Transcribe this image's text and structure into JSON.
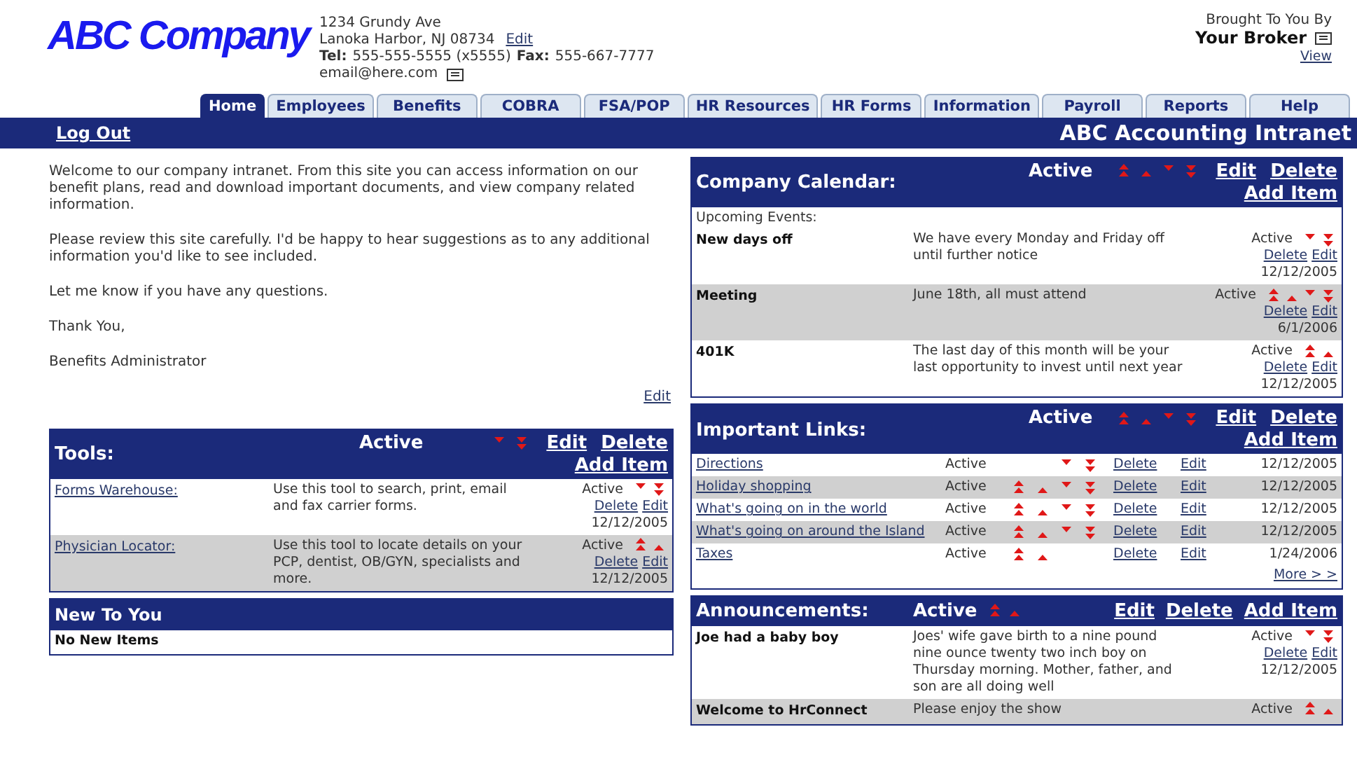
{
  "header": {
    "logo": "ABC Company",
    "address_lines": [
      "1234 Grundy Ave",
      "Lanoka Harbor, NJ 08734"
    ],
    "address_edit": "Edit",
    "tel_label": "Tel:",
    "tel": "555-555-5555 (x5555)",
    "fax_label": "Fax:",
    "fax": "555-667-7777",
    "email": "email@here.com",
    "broker": {
      "caption": "Brought To You By",
      "name": "Your Broker",
      "view": "View"
    }
  },
  "tabs": [
    {
      "label": "Home",
      "selected": true
    },
    {
      "label": "Employees",
      "selected": false
    },
    {
      "label": "Benefits",
      "selected": false
    },
    {
      "label": "COBRA",
      "selected": false
    },
    {
      "label": "FSA/POP",
      "selected": false
    },
    {
      "label": "HR Resources",
      "selected": false
    },
    {
      "label": "HR Forms",
      "selected": false
    },
    {
      "label": "Information",
      "selected": false
    },
    {
      "label": "Payroll",
      "selected": false
    },
    {
      "label": "Reports",
      "selected": false
    },
    {
      "label": "Help",
      "selected": false
    }
  ],
  "bar": {
    "logout": "Log Out",
    "title": "ABC Accounting Intranet"
  },
  "welcome": {
    "paragraphs": [
      "Welcome to our company intranet. From this site you can access information on our benefit plans, read and download important documents, and view company related information.",
      "Please review this site carefully. I'd be happy to hear suggestions as to any additional information you'd like to see included.",
      "Let me know if you have any questions.",
      "Thank You,",
      "Benefits Administrator"
    ],
    "edit": "Edit"
  },
  "tools": {
    "title": "Tools:",
    "header": {
      "status": "Active",
      "moves": {
        "top": false,
        "up": false,
        "down": true,
        "bottom": true
      },
      "actions": [
        "Edit",
        "Delete",
        "Add Item"
      ]
    },
    "rows": [
      {
        "name": "Forms Warehouse:",
        "description": "Use this tool to search, print, email and fax carrier forms.",
        "status": "Active",
        "moves": {
          "top": false,
          "up": false,
          "down": true,
          "bottom": true
        },
        "delete": "Delete",
        "edit": "Edit",
        "date": "12/12/2005"
      },
      {
        "name": "Physician Locator:",
        "description": "Use this tool to locate details on your PCP, dentist, OB/GYN, specialists and more.",
        "status": "Active",
        "moves": {
          "top": true,
          "up": true,
          "down": false,
          "bottom": false
        },
        "delete": "Delete",
        "edit": "Edit",
        "date": "12/12/2005"
      }
    ]
  },
  "new_to_you": {
    "title": "New To You",
    "message": "No New Items"
  },
  "calendar": {
    "title": "Company Calendar:",
    "header": {
      "status": "Active",
      "moves": {
        "top": true,
        "up": true,
        "down": true,
        "bottom": true
      },
      "actions": [
        "Edit",
        "Delete",
        "Add Item"
      ]
    },
    "subtitle": "Upcoming Events:",
    "rows": [
      {
        "title": "New days off",
        "description": "We have every Monday and Friday off until further notice",
        "status": "Active",
        "moves": {
          "top": false,
          "up": false,
          "down": true,
          "bottom": true
        },
        "delete": "Delete",
        "edit": "Edit",
        "date": "12/12/2005"
      },
      {
        "title": "Meeting",
        "description": "June 18th, all must attend",
        "status": "Active",
        "moves": {
          "top": true,
          "up": true,
          "down": true,
          "bottom": true
        },
        "delete": "Delete",
        "edit": "Edit",
        "date": "6/1/2006"
      },
      {
        "title": "401K",
        "description": "The last day of this month will be your last opportunity to invest until next year",
        "status": "Active",
        "moves": {
          "top": true,
          "up": true,
          "down": false,
          "bottom": false
        },
        "delete": "Delete",
        "edit": "Edit",
        "date": "12/12/2005"
      }
    ]
  },
  "links": {
    "title": "Important Links:",
    "header": {
      "status": "Active",
      "moves": {
        "top": true,
        "up": true,
        "down": true,
        "bottom": true
      },
      "actions": [
        "Edit",
        "Delete",
        "Add Item"
      ]
    },
    "rows": [
      {
        "name": "Directions",
        "status": "Active",
        "moves": {
          "top": false,
          "up": false,
          "down": true,
          "bottom": true
        },
        "delete": "Delete",
        "edit": "Edit",
        "date": "12/12/2005"
      },
      {
        "name": "Holiday shopping",
        "status": "Active",
        "moves": {
          "top": true,
          "up": true,
          "down": true,
          "bottom": true
        },
        "delete": "Delete",
        "edit": "Edit",
        "date": "12/12/2005"
      },
      {
        "name": "What's going on in the world",
        "status": "Active",
        "moves": {
          "top": true,
          "up": true,
          "down": true,
          "bottom": true
        },
        "delete": "Delete",
        "edit": "Edit",
        "date": "12/12/2005"
      },
      {
        "name": "What's going on around the Island",
        "status": "Active",
        "moves": {
          "top": true,
          "up": true,
          "down": true,
          "bottom": true
        },
        "delete": "Delete",
        "edit": "Edit",
        "date": "12/12/2005"
      },
      {
        "name": "Taxes",
        "status": "Active",
        "moves": {
          "top": true,
          "up": true,
          "down": false,
          "bottom": false
        },
        "delete": "Delete",
        "edit": "Edit",
        "date": "1/24/2006"
      }
    ],
    "more": "More > >"
  },
  "announcements": {
    "title": "Announcements:",
    "header": {
      "status": "Active",
      "moves": {
        "top": true,
        "up": true,
        "down": false,
        "bottom": false
      },
      "actions": [
        "Edit",
        "Delete",
        "Add Item"
      ]
    },
    "rows": [
      {
        "title": "Joe had a baby boy",
        "description": "Joes' wife gave birth to a nine pound nine ounce twenty two inch boy on Thursday morning. Mother, father, and son are all doing well",
        "status": "Active",
        "moves": {
          "top": false,
          "up": false,
          "down": true,
          "bottom": true
        },
        "delete": "Delete",
        "edit": "Edit",
        "date": "12/12/2005"
      },
      {
        "title": "Welcome to HrConnect",
        "description": "Please enjoy the show",
        "status": "Active",
        "moves": {
          "top": true,
          "up": true,
          "down": false,
          "bottom": false
        }
      }
    ]
  }
}
